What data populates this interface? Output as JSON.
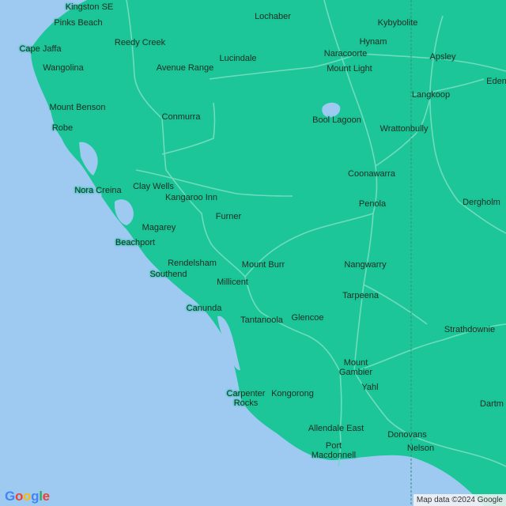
{
  "map": {
    "places": [
      {
        "id": "kingston-se",
        "name": "Kingston SE"
      },
      {
        "id": "pinks-beach",
        "name": "Pinks Beach"
      },
      {
        "id": "lochaber",
        "name": "Lochaber"
      },
      {
        "id": "kybybolite",
        "name": "Kybybolite"
      },
      {
        "id": "cape-jaffa",
        "name": "Cape Jaffa"
      },
      {
        "id": "reedy-creek",
        "name": "Reedy Creek"
      },
      {
        "id": "hynam",
        "name": "Hynam"
      },
      {
        "id": "wangolina",
        "name": "Wangolina"
      },
      {
        "id": "naracoorte",
        "name": "Naracoorte"
      },
      {
        "id": "apsley",
        "name": "Apsley"
      },
      {
        "id": "lucindale",
        "name": "Lucindale"
      },
      {
        "id": "avenue-range",
        "name": "Avenue Range"
      },
      {
        "id": "mount-light",
        "name": "Mount Light"
      },
      {
        "id": "edenhope",
        "name": "Eden"
      },
      {
        "id": "langkoop",
        "name": "Langkoop"
      },
      {
        "id": "mount-benson",
        "name": "Mount Benson"
      },
      {
        "id": "conmurra",
        "name": "Conmurra"
      },
      {
        "id": "bool-lagoon",
        "name": "Bool Lagoon"
      },
      {
        "id": "robe",
        "name": "Robe"
      },
      {
        "id": "wrattonbully",
        "name": "Wrattonbully"
      },
      {
        "id": "coonawarra",
        "name": "Coonawarra"
      },
      {
        "id": "clay-wells",
        "name": "Clay Wells"
      },
      {
        "id": "nora-creina",
        "name": "Nora Creina"
      },
      {
        "id": "kangaroo-inn",
        "name": "Kangaroo Inn"
      },
      {
        "id": "penola",
        "name": "Penola"
      },
      {
        "id": "dergholm",
        "name": "Dergholm"
      },
      {
        "id": "furner",
        "name": "Furner"
      },
      {
        "id": "magarey",
        "name": "Magarey"
      },
      {
        "id": "beachport",
        "name": "Beachport"
      },
      {
        "id": "rendelsham",
        "name": "Rendelsham"
      },
      {
        "id": "mount-burr",
        "name": "Mount Burr"
      },
      {
        "id": "nangwarry",
        "name": "Nangwarry"
      },
      {
        "id": "southend",
        "name": "Southend"
      },
      {
        "id": "millicent",
        "name": "Millicent"
      },
      {
        "id": "tarpeena",
        "name": "Tarpeena"
      },
      {
        "id": "canunda",
        "name": "Canunda"
      },
      {
        "id": "glencoe",
        "name": "Glencoe"
      },
      {
        "id": "tantanoola",
        "name": "Tantanoola"
      },
      {
        "id": "strathdownie",
        "name": "Strathdownie"
      },
      {
        "id": "mount-gambier",
        "name": "Mount\nGambier"
      },
      {
        "id": "yahl",
        "name": "Yahl"
      },
      {
        "id": "dartmoor",
        "name": "Dartm"
      },
      {
        "id": "carpenter-rocks",
        "name": "Carpenter\nRocks"
      },
      {
        "id": "kongorong",
        "name": "Kongorong"
      },
      {
        "id": "allendale-east",
        "name": "Allendale East"
      },
      {
        "id": "donovans",
        "name": "Donovans"
      },
      {
        "id": "port-macdonnell",
        "name": "Port\nMacdonnell"
      },
      {
        "id": "nelson",
        "name": "Nelson"
      }
    ],
    "colors": {
      "water": "#9ecaf2",
      "land": "#1dc698",
      "road": "#6fdcbc",
      "border": "#3a8c73"
    },
    "logo": [
      "G",
      "o",
      "o",
      "g",
      "l",
      "e"
    ],
    "logo_colors": [
      "#4285f4",
      "#ea4335",
      "#fbbc05",
      "#4285f4",
      "#34a853",
      "#ea4335"
    ],
    "attribution": "Map data ©2024 Google"
  }
}
